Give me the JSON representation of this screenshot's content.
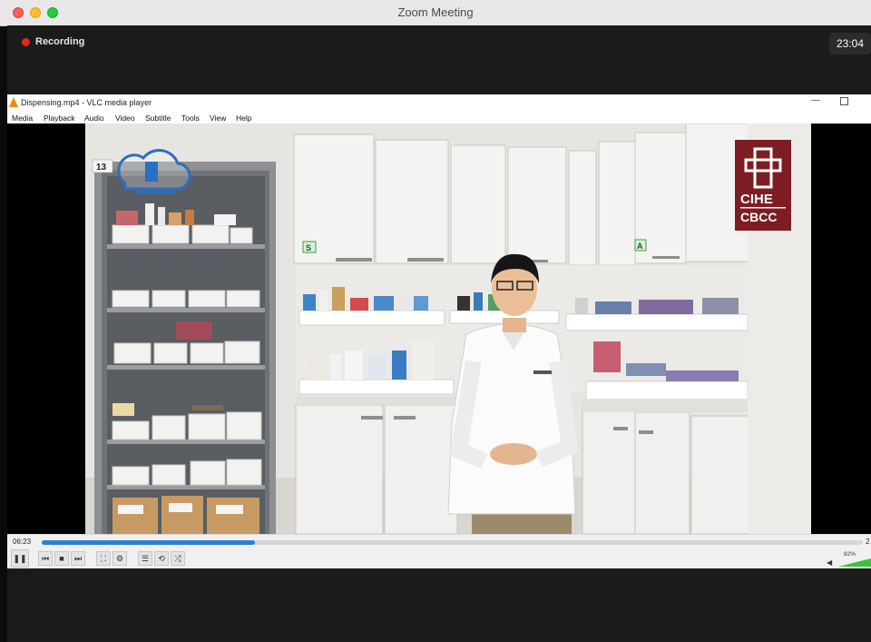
{
  "window": {
    "title": "Zoom Meeting"
  },
  "zoom": {
    "recording_label": "Recording",
    "timer": "23:04"
  },
  "vlc": {
    "title": "Dispensing.mp4 - VLC media player",
    "menu": [
      "Media",
      "Playback",
      "Audio",
      "Video",
      "Subtitle",
      "Tools",
      "View",
      "Help"
    ],
    "video": {
      "shelf_number": "13",
      "bin_labels": [
        "S",
        "A"
      ],
      "logo_top": "CIHE",
      "logo_bottom": "CBCC"
    },
    "playback": {
      "elapsed": "06:23",
      "remaining": "2",
      "progress": 0.26,
      "volume_label": "82%"
    },
    "buttons": {
      "pause": "❚❚",
      "prev": "⏮",
      "stop": "■",
      "next": "⏭",
      "fullscreen": "⛶",
      "extended": "⚙",
      "playlist": "☰",
      "loop": "⟲",
      "shuffle": "⤮"
    }
  },
  "colors": {
    "recording": "#e0291f",
    "seek": "#2d7fd3",
    "volume": "#3fbf3f",
    "logo_bg": "#7d1d23"
  }
}
